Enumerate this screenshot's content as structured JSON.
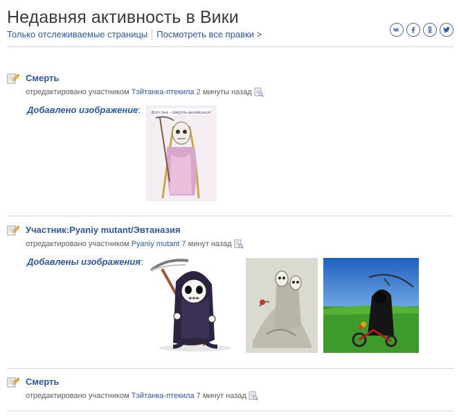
{
  "header": {
    "title": "Недавняя активность в Вики",
    "link_watched": "Только отслеживаемые страницы",
    "link_all": "Посмотреть все правки >"
  },
  "socials": {
    "vk": "vk",
    "facebook": "f",
    "odnoklassniki": "ok",
    "twitter": "t"
  },
  "entries": [
    {
      "title": "Смерть",
      "meta_prefix": "отредактировано участником",
      "user": "Тэйтанка-птекила",
      "time": "2 минуты назад",
      "added_label": "Добавлено изображение",
      "colon": ":",
      "thumb_caption": "Вот она - смерть-анимешник!"
    },
    {
      "title": "Участник:Pyaniy mutant/Эвтаназия",
      "meta_prefix": "отредактировано участником",
      "user": "Pyaniy mutant",
      "time": "7 минут назад",
      "added_label": "Добавлены изображения",
      "colon": ":"
    },
    {
      "title": "Смерть",
      "meta_prefix": "отредактировано участником",
      "user": "Тэйтанка-птекила",
      "time": "7 минут назад"
    }
  ],
  "colors": {
    "link": "#2a57a5",
    "divider": "#d4d4d4",
    "text": "#3a3a3a"
  }
}
